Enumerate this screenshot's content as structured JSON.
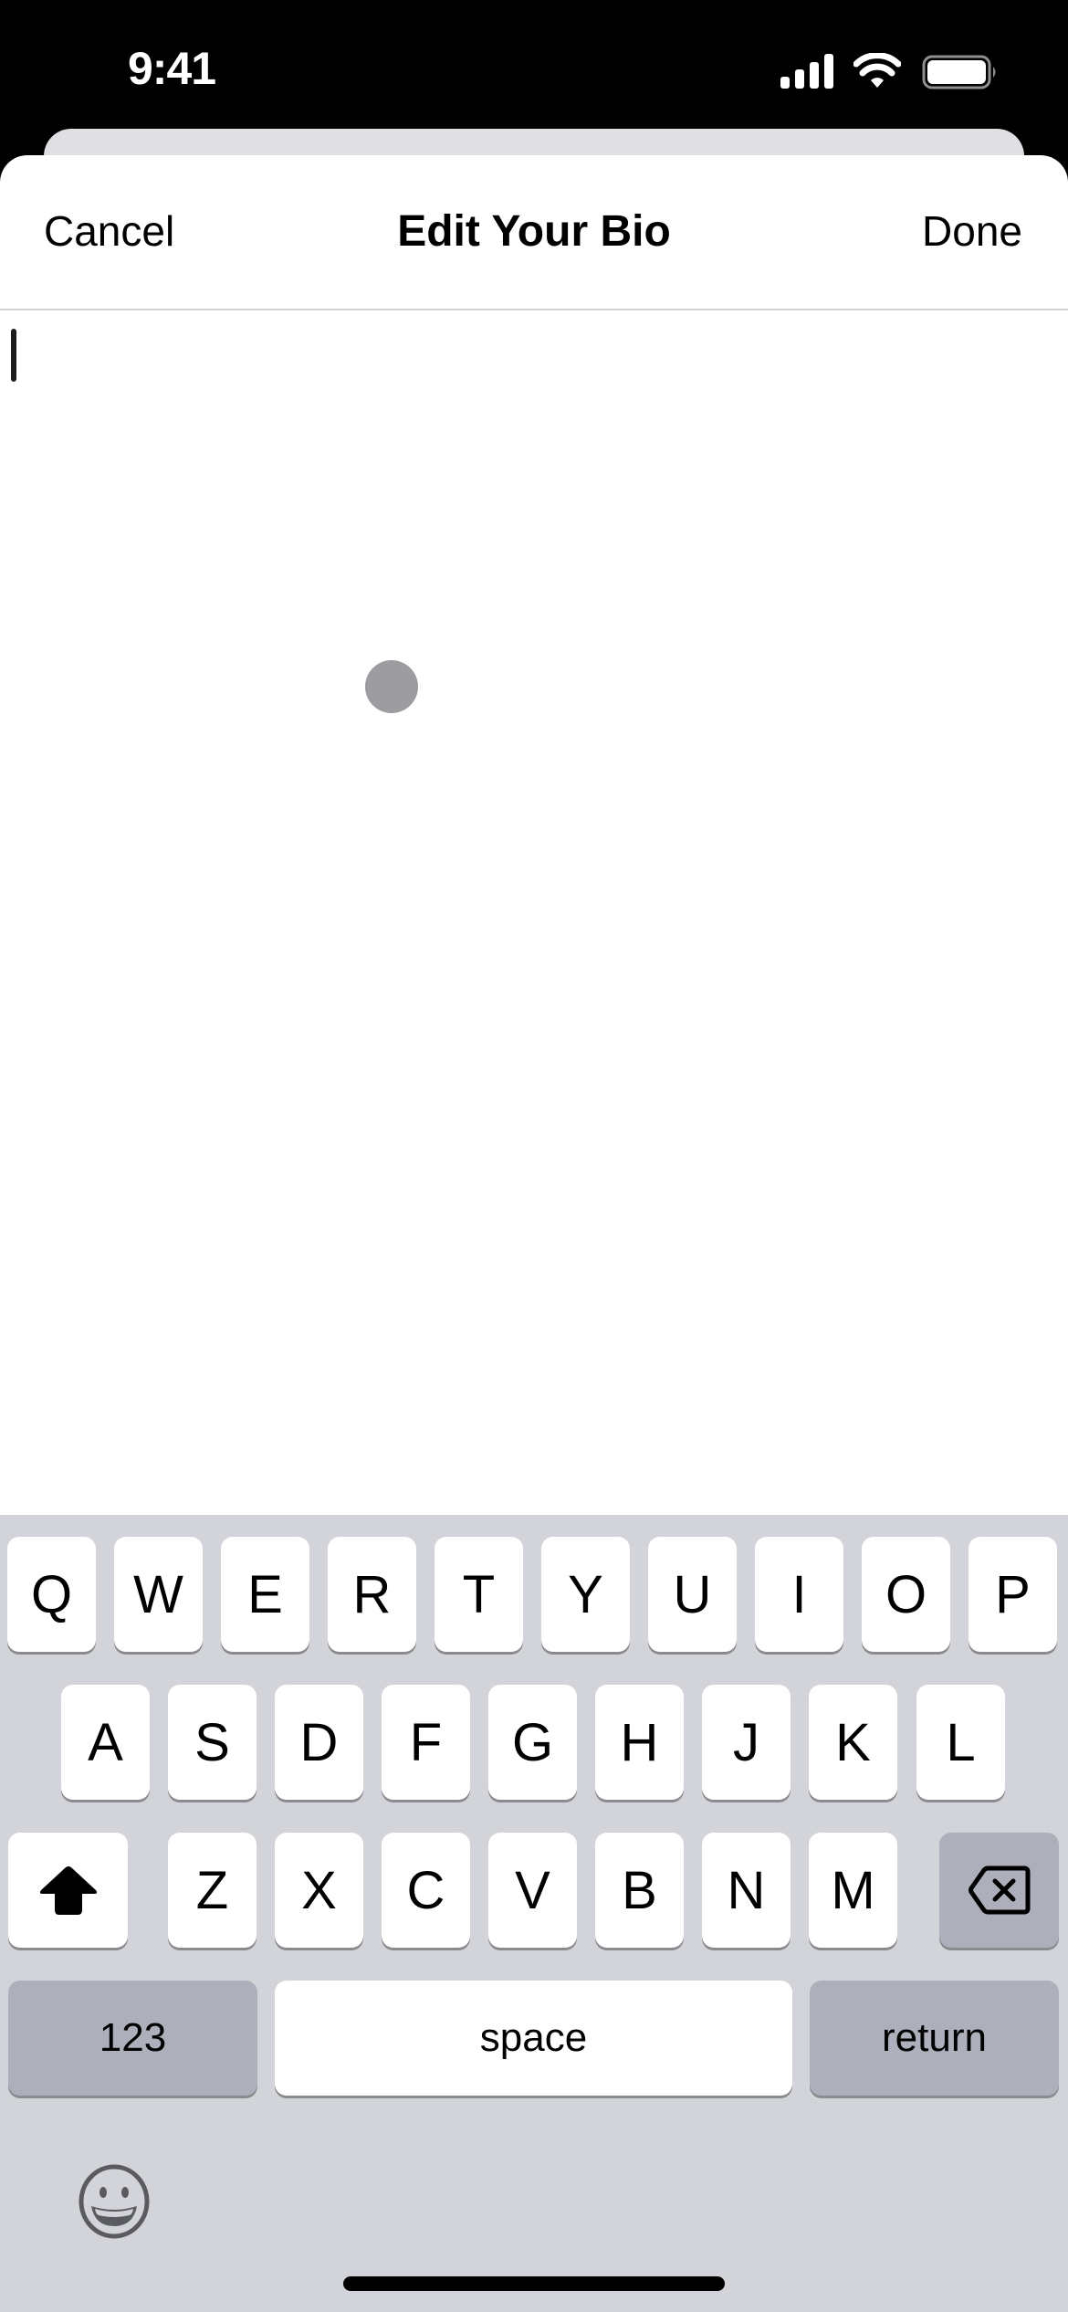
{
  "status_bar": {
    "time": "9:41",
    "icons": [
      "cellular-signal-icon",
      "wifi-icon",
      "battery-icon"
    ]
  },
  "nav": {
    "cancel_label": "Cancel",
    "title": "Edit Your Bio",
    "done_label": "Done"
  },
  "editor": {
    "value": "",
    "placeholder": ""
  },
  "keyboard": {
    "row1": [
      "Q",
      "W",
      "E",
      "R",
      "T",
      "Y",
      "U",
      "I",
      "O",
      "P"
    ],
    "row2": [
      "A",
      "S",
      "D",
      "F",
      "G",
      "H",
      "J",
      "K",
      "L"
    ],
    "row3": [
      "Z",
      "X",
      "C",
      "V",
      "B",
      "N",
      "M"
    ],
    "shift_icon": "shift-arrow-icon",
    "delete_icon": "delete-backspace-icon",
    "numbers_label": "123",
    "space_label": "space",
    "return_label": "return",
    "emoji_icon": "emoji-face-icon"
  },
  "colors": {
    "keyboard_bg": "#d3d4d9",
    "function_key": "#adb0bb",
    "letter_key": "#ffffff",
    "touch_indicator": "#9d9da1"
  }
}
